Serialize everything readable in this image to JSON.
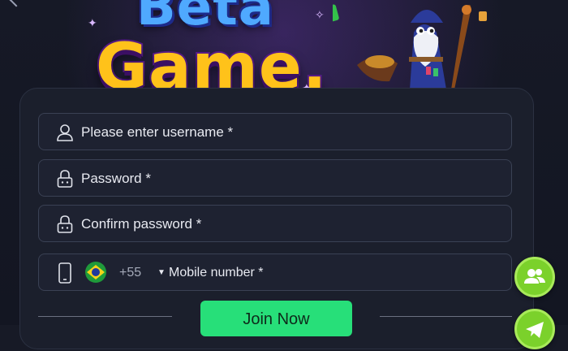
{
  "banner": {
    "logo_line1": "Beta",
    "logo_line2": "Game."
  },
  "form": {
    "username_placeholder": "Please enter username *",
    "password_placeholder": "Password *",
    "confirm_password_placeholder": "Confirm password *",
    "phone": {
      "country_flag": "brazil-flag-icon",
      "country_code": "+55",
      "placeholder": "Mobile number *"
    },
    "submit_label": "Join Now"
  },
  "floating_buttons": [
    {
      "icon": "contacts-icon"
    },
    {
      "icon": "telegram-icon"
    }
  ],
  "colors": {
    "background": "#171a26",
    "field_border": "#3a4154",
    "primary_button": "#27df79",
    "fab_green": "#7bd12b",
    "logo_blue": "#4fa9ff",
    "logo_yellow": "#ffc21a"
  }
}
